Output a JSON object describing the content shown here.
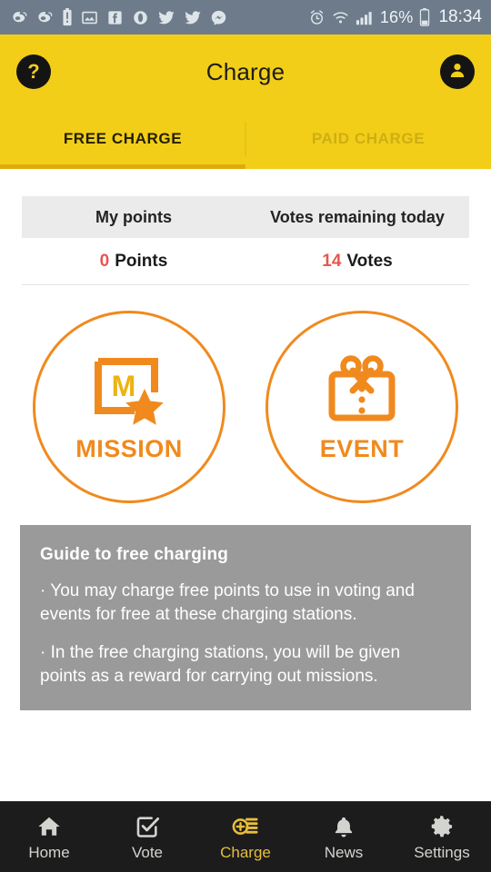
{
  "statusbar": {
    "left_icons": [
      "weibo-icon",
      "weibo-icon",
      "battery-alert-icon",
      "gallery-icon",
      "facebook-icon",
      "opera-icon",
      "twitter-icon",
      "twitter-icon",
      "messenger-icon"
    ],
    "alarm_icon": "alarm-clock-icon",
    "wifi_icon": "wifi-icon",
    "signal_icon": "cellular-signal-icon",
    "battery_percent": "16%",
    "battery_icon": "battery-icon",
    "time": "18:34"
  },
  "appbar": {
    "title": "Charge",
    "help_icon": "question-mark-icon",
    "help_glyph": "?",
    "profile_icon": "account-avatar-icon"
  },
  "tabs": [
    {
      "label": "FREE CHARGE",
      "active": true
    },
    {
      "label": "PAID CHARGE",
      "active": false
    }
  ],
  "points_table": {
    "headers": [
      "My points",
      "Votes remaining today"
    ],
    "rows": [
      {
        "number": "0",
        "unit": "Points"
      },
      {
        "number": "14",
        "unit": "Votes"
      }
    ]
  },
  "shortcuts": [
    {
      "label": "MISSION",
      "icon": "mission-frame-star-icon"
    },
    {
      "label": "EVENT",
      "icon": "gift-box-icon"
    }
  ],
  "guide": {
    "title": "Guide to free charging",
    "paragraphs": [
      "· You may charge free points to use in voting and events for free at these charging stations.",
      "· In the free charging stations, you will be given points as a reward for carrying out missions."
    ]
  },
  "bottom_nav": [
    {
      "label": "Home",
      "icon": "home-icon",
      "active": false
    },
    {
      "label": "Vote",
      "icon": "checkbox-check-icon",
      "active": false
    },
    {
      "label": "Charge",
      "icon": "coins-plus-icon",
      "active": true
    },
    {
      "label": "News",
      "icon": "bell-icon",
      "active": false
    },
    {
      "label": "Settings",
      "icon": "gear-icon",
      "active": false
    }
  ],
  "colors": {
    "header_yellow": "#f2ce18",
    "tab_indicator": "#e0ab0b",
    "orange": "#f08a1e",
    "accent_red": "#e8564f",
    "guide_gray": "#9a9a9a",
    "nav_dark": "#1c1c1c",
    "nav_active": "#e8bd3c",
    "statusbar_gray": "#6d7b8a"
  }
}
